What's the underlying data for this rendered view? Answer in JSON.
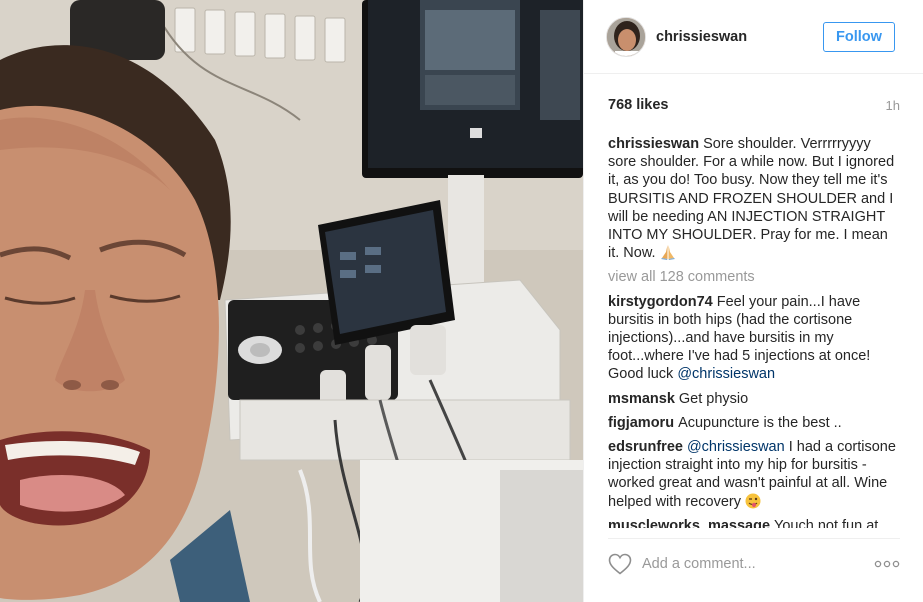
{
  "post": {
    "username": "chrissieswan",
    "follow_label": "Follow",
    "likes": "768 likes",
    "time": "1h"
  },
  "caption": {
    "user": "chrissieswan",
    "text": "Sore shoulder. Verrrrryyyy sore shoulder. For a while now. But I ignored it, as you do! Too busy. Now they tell me it's BURSITIS AND FROZEN SHOULDER and I will be needing AN INJECTION STRAIGHT INTO MY SHOULDER. Pray for me. I mean it. Now.",
    "emoji": "praying-hands"
  },
  "view_all": "view all 128 comments",
  "comments": [
    {
      "user": "kirstygordon74",
      "text": "Feel your pain...I have bursitis in both hips (had the cortisone injections)...and have bursitis in my foot...where I've had 5 injections at once! Good luck",
      "mention": "@chrissieswan"
    },
    {
      "user": "msmansk",
      "text": "Get physio"
    },
    {
      "user": "figjamoru",
      "text": "Acupuncture is the best .."
    },
    {
      "user": "edsrunfree",
      "mention": "@chrissieswan",
      "text": "I had a cortisone injection straight into my hip for bursitis - worked great and wasn't painful at all. Wine helped with recovery",
      "emoji": "winking-tongue-face"
    },
    {
      "user": "muscleworks_massage",
      "text": "Youch not fun at"
    }
  ],
  "footer": {
    "placeholder": "Add a comment...",
    "heart_icon": "heart-outline-icon",
    "more_icon": "more-options-icon"
  },
  "colors": {
    "accent": "#3897f0",
    "mention": "#003569",
    "muted": "#999999",
    "text": "#262626"
  }
}
